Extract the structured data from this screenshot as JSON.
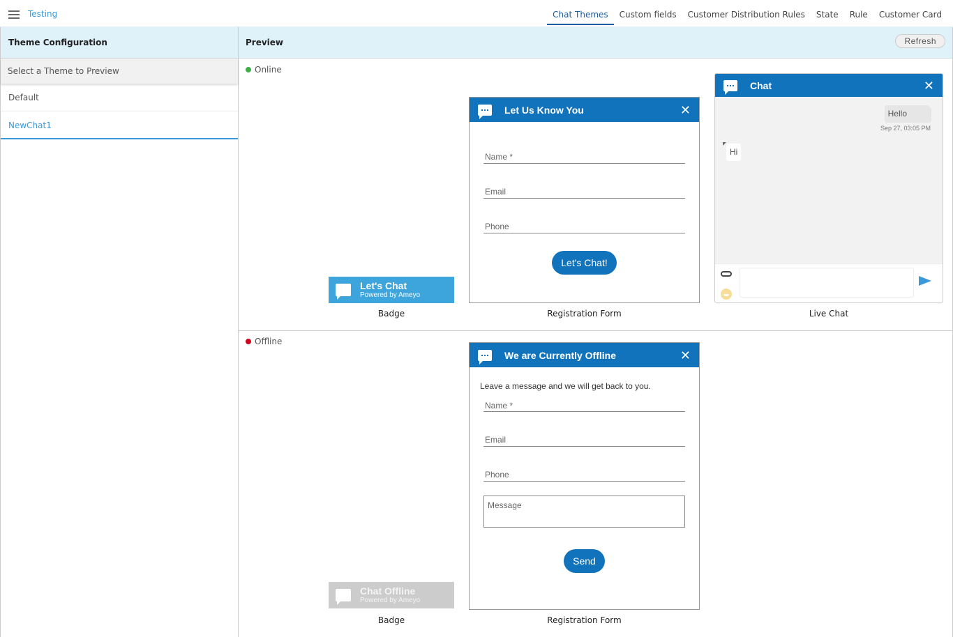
{
  "header": {
    "app_title": "Testing",
    "tabs": [
      {
        "label": "Chat Themes",
        "active": true
      },
      {
        "label": "Custom fields"
      },
      {
        "label": "Customer Distribution Rules"
      },
      {
        "label": "State"
      },
      {
        "label": "Rule"
      },
      {
        "label": "Customer Card"
      }
    ]
  },
  "theme_config": {
    "title": "Theme Configuration",
    "list_header": "Select a Theme to Preview",
    "themes": [
      {
        "label": "Default"
      },
      {
        "label": "NewChat1",
        "selected": true
      }
    ]
  },
  "preview": {
    "title": "Preview",
    "refresh_label": "Refresh",
    "online": {
      "status_label": "Online",
      "status_color": "#3fae49",
      "badge": {
        "title": "Let's Chat",
        "subtitle": "Powered by Ameyo",
        "caption": "Badge"
      },
      "registration_form": {
        "title": "Let Us Know You",
        "fields": [
          {
            "placeholder": "Name *"
          },
          {
            "placeholder": "Email"
          },
          {
            "placeholder": "Phone"
          }
        ],
        "button_label": "Let's Chat!",
        "caption": "Registration Form"
      },
      "live_chat": {
        "title": "Chat",
        "messages": [
          {
            "direction": "outgoing",
            "text": "Hello",
            "time": "Sep 27, 03:05 PM"
          },
          {
            "direction": "incoming",
            "text": "Hi"
          }
        ],
        "caption": "Live Chat"
      }
    },
    "offline": {
      "status_label": "Offline",
      "status_color": "#d0021b",
      "badge": {
        "title": "Chat Offline",
        "subtitle": "Powered by Ameyo",
        "caption": "Badge"
      },
      "registration_form": {
        "title": "We are Currently Offline",
        "intro": "Leave a message and we will get back to you.",
        "fields": [
          {
            "placeholder": "Name *"
          },
          {
            "placeholder": "Email"
          },
          {
            "placeholder": "Phone"
          }
        ],
        "message_placeholder": "Message",
        "button_label": "Send",
        "caption": "Registration Form"
      }
    }
  },
  "colors": {
    "brand_blue": "#1173bb",
    "badge_blue": "#3da4dc",
    "header_bg": "#dff2fa",
    "link_blue": "#3a9ad9"
  }
}
